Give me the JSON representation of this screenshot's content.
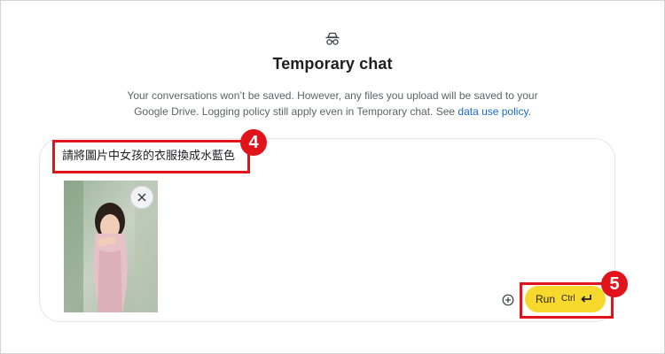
{
  "header": {
    "icon": "incognito-icon",
    "title": "Temporary chat",
    "description_line1": "Your conversations won’t be saved. However, any files you upload will be saved to your",
    "description_line2_prefix": "Google Drive. Logging policy still apply even in Temporary chat. See ",
    "description_link": "data use policy",
    "description_suffix": "."
  },
  "composer": {
    "prompt_text": "請將圖片中女孩的衣服換成水藍色",
    "attachment_icon": "image-thumbnail",
    "remove_icon": "close-icon",
    "add_icon": "plus-circle-icon",
    "run_label": "Run",
    "shortcut_label": "Ctrl",
    "shortcut_icon": "enter-icon"
  },
  "annotations": {
    "step_prompt": "4",
    "step_run": "5",
    "highlight_color": "#e0141a"
  },
  "colors": {
    "accent": "#f7d92d",
    "link": "#1a6ac9"
  }
}
